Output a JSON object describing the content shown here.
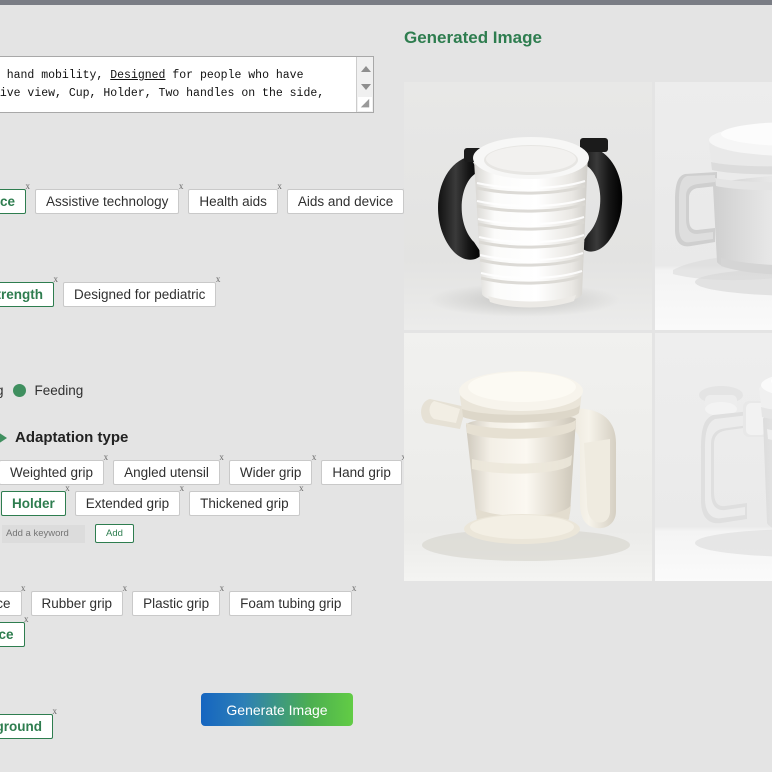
{
  "prompt": {
    "line1": "have limited hand mobility, Designed for people who have",
    "line1_pre": "have limited hand mobility, ",
    "line1_underline": "Designed",
    "line1_post": " for people who have",
    "line2": "nd, Perspective view, Cup, Holder, Two handles on the side,"
  },
  "chip_rows": [
    {
      "name": "product-category-row",
      "chips": [
        {
          "label": "device",
          "selected": true,
          "truncated": true
        },
        {
          "label": "Assistive technology",
          "selected": false
        },
        {
          "label": "Health aids",
          "selected": false
        },
        {
          "label": "Aids and device",
          "selected": false
        }
      ]
    },
    {
      "name": "user-condition-row",
      "chips": [
        {
          "label": "hand strength",
          "selected": true,
          "truncated": true
        },
        {
          "label": "Designed for pediatric",
          "selected": false
        }
      ]
    }
  ],
  "activity": {
    "cut_label": "g",
    "selected_option": "Feeding",
    "radio_color": "#3f8f5f"
  },
  "adaptation": {
    "section_title": "Adaptation type",
    "rows": [
      [
        {
          "label": "Weighted grip",
          "selected": false
        },
        {
          "label": "Angled utensil",
          "selected": false
        },
        {
          "label": "Wider grip",
          "selected": false
        },
        {
          "label": "Hand grip",
          "selected": false
        }
      ],
      [
        {
          "label": "Holder",
          "selected": true
        },
        {
          "label": "Extended grip",
          "selected": false
        },
        {
          "label": "Thickened grip",
          "selected": false
        }
      ]
    ],
    "keyword_placeholder": "Add a keyword",
    "add_label": "Add"
  },
  "surface_rows": [
    [
      {
        "label": "urface",
        "selected": false,
        "truncated": true
      },
      {
        "label": "Rubber grip",
        "selected": false
      },
      {
        "label": "Plastic grip",
        "selected": false
      },
      {
        "label": "Foam tubing grip",
        "selected": false
      }
    ],
    [
      {
        "label": "urface",
        "selected": true,
        "truncated": true
      }
    ]
  ],
  "background_row": [
    {
      "label": "ackground",
      "selected": true,
      "truncated": true
    }
  ],
  "generate_button": {
    "label": "Generate Image",
    "gradient_from": "#1565c0",
    "gradient_to": "#62cc45"
  },
  "results": {
    "title": "Generated Image",
    "images": [
      {
        "alt": "white ribbed two-handled cup with black handles"
      },
      {
        "alt": "white grey cup with square handle"
      },
      {
        "alt": "beige mug with lid and large side handle"
      },
      {
        "alt": "white mug with square handle and lid knob"
      }
    ]
  },
  "icons": {
    "chip_remove": "x",
    "disclosure": "triangle-right-icon",
    "scroll_up": "caret-up-icon",
    "scroll_down": "caret-down-icon",
    "resize": "resize-grip-icon"
  },
  "colors": {
    "page_bg": "#e4e4e4",
    "topbar": "#7a7d85",
    "accent_green": "#2e7d4f"
  }
}
